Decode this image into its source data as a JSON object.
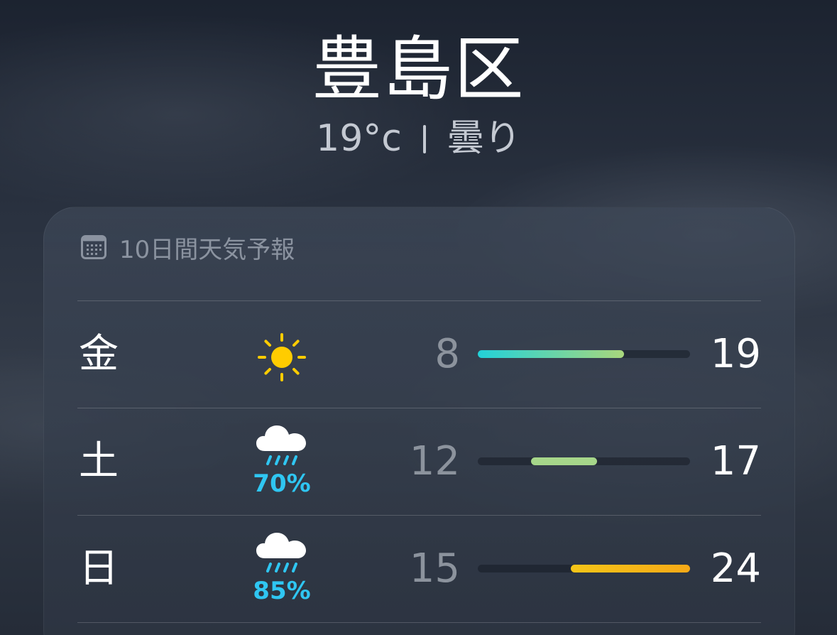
{
  "location": {
    "city": "豊島区",
    "temperature": "19°c",
    "condition": "曇り"
  },
  "forecast": {
    "title": "10日間天気予報",
    "range_min": 8,
    "range_max": 24,
    "days": [
      {
        "day": "金",
        "icon": "sun-icon",
        "precip": null,
        "low": "8",
        "high": "19",
        "bar_colors": [
          "#22d1d9",
          "#a9d77c"
        ]
      },
      {
        "day": "土",
        "icon": "rain-cloud-icon",
        "precip": "70%",
        "low": "12",
        "high": "17",
        "bar_colors": [
          "#a6d68a",
          "#a6d68a"
        ]
      },
      {
        "day": "日",
        "icon": "rain-cloud-icon",
        "precip": "85%",
        "low": "15",
        "high": "24",
        "bar_colors": [
          "#f5c518",
          "#f6a917"
        ]
      }
    ]
  },
  "colors": {
    "precip": "#2fc6f2",
    "sun": "#ffcc00"
  }
}
